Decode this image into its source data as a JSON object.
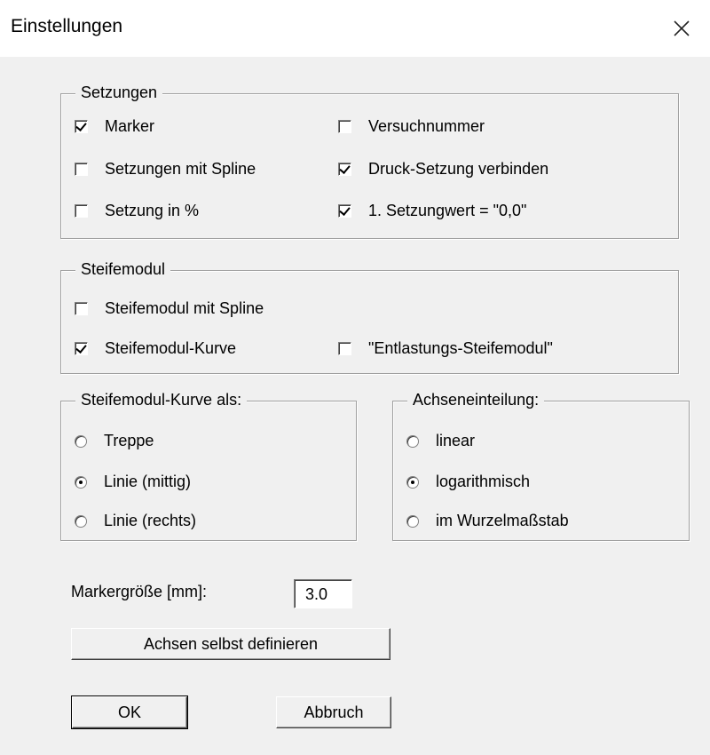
{
  "window": {
    "title": "Einstellungen"
  },
  "setzungen": {
    "legend": "Setzungen",
    "items": [
      {
        "label": "Marker",
        "checked": true
      },
      {
        "label": "Versuchnummer",
        "checked": false
      },
      {
        "label": "Setzungen mit Spline",
        "checked": false
      },
      {
        "label": "Druck-Setzung verbinden",
        "checked": true
      },
      {
        "label": "Setzung in %",
        "checked": false
      },
      {
        "label": "1. Setzungwert = \"0,0\"",
        "checked": true
      }
    ]
  },
  "steifemodul": {
    "legend": "Steifemodul",
    "items": [
      {
        "label": "Steifemodul mit Spline",
        "checked": false
      },
      {
        "label": "Steifemodul-Kurve",
        "checked": true
      },
      {
        "label": "\"Entlastungs-Steifemodul\"",
        "checked": false
      }
    ]
  },
  "kurve": {
    "legend": "Steifemodul-Kurve als:",
    "options": [
      {
        "label": "Treppe",
        "selected": false
      },
      {
        "label": "Linie (mittig)",
        "selected": true
      },
      {
        "label": "Linie (rechts)",
        "selected": false
      }
    ]
  },
  "achsen": {
    "legend": "Achseneinteilung:",
    "options": [
      {
        "label": "linear",
        "selected": false
      },
      {
        "label": "logarithmisch",
        "selected": true
      },
      {
        "label": "im Wurzelmaßstab",
        "selected": false
      }
    ]
  },
  "marker_size": {
    "label": "Markergröße [mm]:",
    "value": "3.0"
  },
  "buttons": {
    "define_axes": "Achsen selbst definieren",
    "ok": "OK",
    "cancel": "Abbruch"
  },
  "icons": {
    "close": "close-icon"
  }
}
